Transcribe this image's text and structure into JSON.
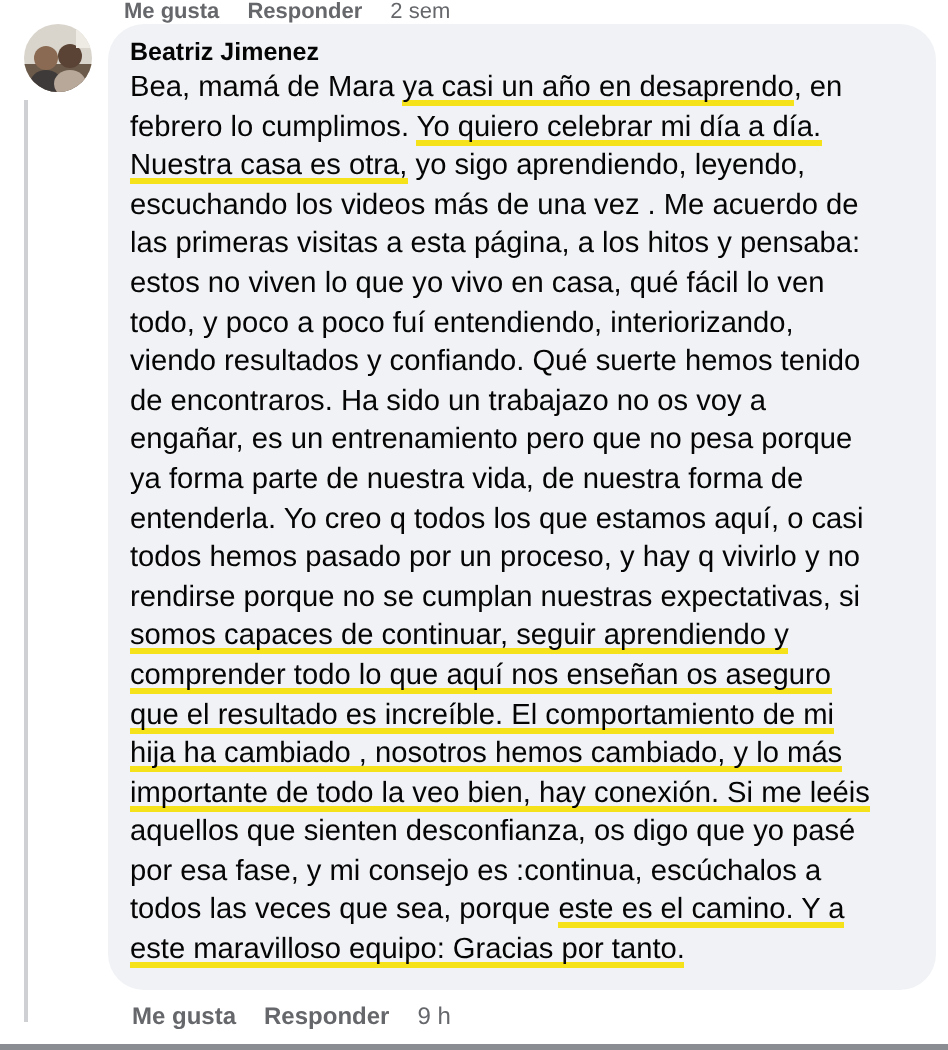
{
  "previous_actions": {
    "like": "Me gusta",
    "reply": "Responder",
    "time": "2 sem"
  },
  "comment": {
    "author": "Beatriz Jimenez",
    "lines": [
      [
        {
          "text": "Bea, mamá de Mara ",
          "highlighted": false
        },
        {
          "text": "ya casi un año en desaprendo",
          "highlighted": true
        },
        {
          "text": ", en",
          "highlighted": false
        }
      ],
      [
        {
          "text": "febrero lo cumplimos. ",
          "highlighted": false
        },
        {
          "text": "Yo quiero celebrar mi día a día.",
          "highlighted": true
        }
      ],
      [
        {
          "text": "Nuestra casa es otra,",
          "highlighted": true
        },
        {
          "text": " yo sigo aprendiendo, leyendo,",
          "highlighted": false
        }
      ],
      [
        {
          "text": "escuchando los videos más de una vez . Me acuerdo de",
          "highlighted": false
        }
      ],
      [
        {
          "text": "las primeras visitas a esta página, a los hitos y pensaba:",
          "highlighted": false
        }
      ],
      [
        {
          "text": "estos no viven lo que yo vivo en casa, qué fácil lo ven",
          "highlighted": false
        }
      ],
      [
        {
          "text": "todo, y poco a poco fuí entendiendo, interiorizando,",
          "highlighted": false
        }
      ],
      [
        {
          "text": "viendo resultados y confiando. Qué suerte hemos tenido",
          "highlighted": false
        }
      ],
      [
        {
          "text": "de encontraros. Ha sido un trabajazo no os voy a",
          "highlighted": false
        }
      ],
      [
        {
          "text": "engañar, es un entrenamiento pero que no pesa porque",
          "highlighted": false
        }
      ],
      [
        {
          "text": "ya forma parte de nuestra vida, de nuestra forma de",
          "highlighted": false
        }
      ],
      [
        {
          "text": "entenderla. Yo creo q todos los que estamos aquí, o casi",
          "highlighted": false
        }
      ],
      [
        {
          "text": "todos hemos pasado por un proceso, y hay q vivirlo y no",
          "highlighted": false
        }
      ],
      [
        {
          "text": "rendirse porque no se cumplan nuestras expectativas, si",
          "highlighted": false
        }
      ],
      [
        {
          "text": "somos capaces de continuar, seguir aprendiendo y",
          "highlighted": true
        }
      ],
      [
        {
          "text": "comprender todo lo que aquí nos enseñan os aseguro",
          "highlighted": true
        }
      ],
      [
        {
          "text": "que el resultado es increíble. El comportamiento de mi",
          "highlighted": true
        }
      ],
      [
        {
          "text": "hija ha cambiado , nosotros hemos cambiado, y lo más",
          "highlighted": true
        }
      ],
      [
        {
          "text": "importante de todo la veo bien, hay conexión. Si me leéis",
          "highlighted": true
        }
      ],
      [
        {
          "text": "aquellos que sienten desconfianza, os digo que yo pasé",
          "highlighted": false
        }
      ],
      [
        {
          "text": "por esa fase, y mi consejo es :continua, escúchalos a",
          "highlighted": false
        }
      ],
      [
        {
          "text": "todos las veces que sea, porque ",
          "highlighted": false
        },
        {
          "text": "este es el camino. Y a",
          "highlighted": true
        }
      ],
      [
        {
          "text": "este maravilloso equipo: Gracias por tanto.",
          "highlighted": true
        }
      ]
    ],
    "actions": {
      "like": "Me gusta",
      "reply": "Responder",
      "time": "9 h"
    }
  }
}
